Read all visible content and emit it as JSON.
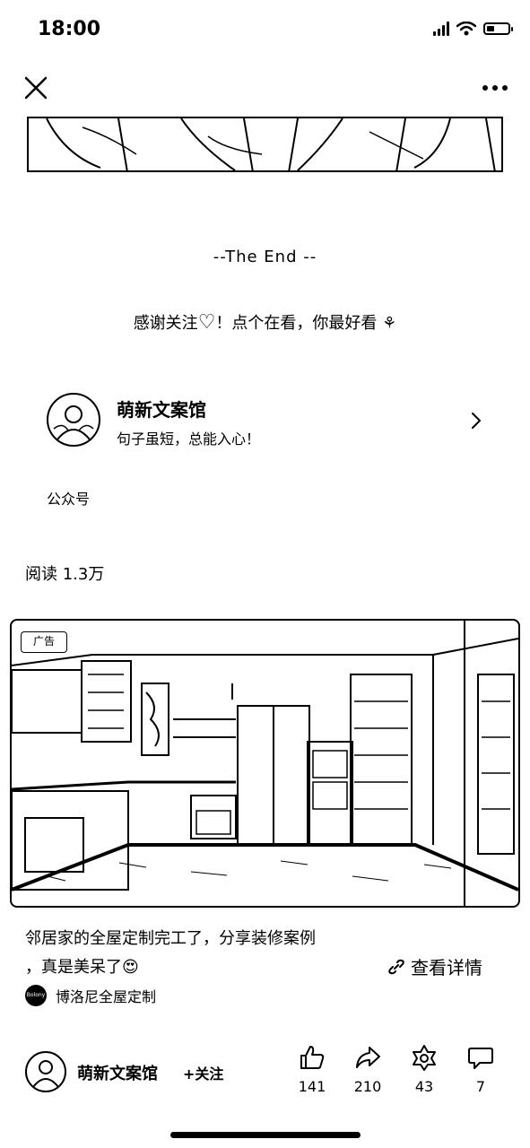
{
  "status": {
    "time": "18:00",
    "battery_level": 0.35
  },
  "nav": {
    "close_icon": "close-icon",
    "more_icon": "more-icon"
  },
  "article": {
    "the_end": "--The  End --",
    "thanks_a": "感谢关注",
    "thanks_b": "！点个在看，你最好看",
    "heart_glyph": "♡",
    "rose_glyph": "⚘"
  },
  "account": {
    "name": "萌新文案馆",
    "description": "句子虽短，总能入心！",
    "type_label": "公众号"
  },
  "reads": "阅读 1.3万",
  "ad": {
    "badge": "广告",
    "title_line1": "邻居家的全屋定制完工了，分享装修案例",
    "title_line2": "，真是美呆了😍",
    "detail_label": "查看详情",
    "brand_logo_text": "Bolony",
    "brand_name": "博洛尼全屋定制"
  },
  "bottom_bar": {
    "name": "萌新文案馆",
    "follow_label": "+关注",
    "like_count": "141",
    "share_count": "210",
    "star_count": "43",
    "comment_count": "7"
  }
}
